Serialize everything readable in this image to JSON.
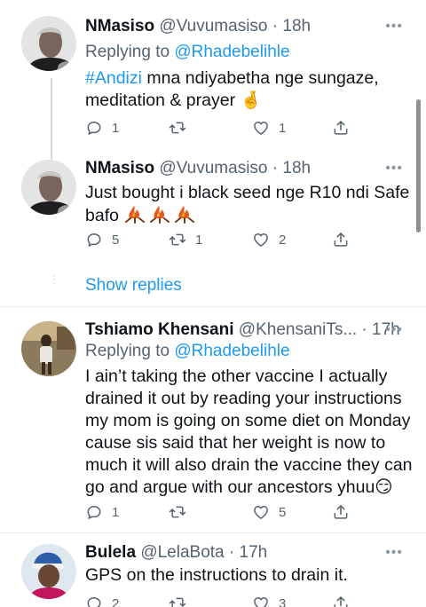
{
  "tweets": [
    {
      "name": "NMasiso",
      "handle": "@Vuvumasiso",
      "time": "18h",
      "replying_label": "Replying to",
      "replying_handle": "@Rhadebelihle",
      "hashtag": "#Andizi",
      "text_line1": " mna ndiyabetha nge sungaze,",
      "text_line2": "meditation & prayer",
      "emoji": "🤞",
      "replies": "1",
      "retweets": "",
      "likes": "1"
    },
    {
      "name": "NMasiso",
      "handle": "@Vuvumasiso",
      "time": "18h",
      "text_line1": "Just bought i black seed nge R10 ndi Safe",
      "text_line2": "bafo",
      "replies": "5",
      "retweets": "1",
      "likes": "2"
    },
    {
      "show_replies": "Show replies"
    },
    {
      "name": "Tshiamo Khensani",
      "handle": "@KhensaniTs...",
      "time": "17h",
      "replying_label": "Replying to",
      "replying_handle": "@Rhadebelihle",
      "lines": [
        "I ain’t taking the other vaccine I actually",
        "drained it out by reading your instructions",
        "my mom is going on some diet on Monday",
        "cause sis said that her weight is now to",
        "much it will also drain the vaccine they can",
        "go and argue with our ancestors yhuu"
      ],
      "emoji": "😏",
      "replies": "1",
      "retweets": "",
      "likes": "5"
    },
    {
      "name": "Bulela",
      "handle": "@LelaBota",
      "time": "17h",
      "text_line1": "GPS on the instructions to drain it.",
      "replies": "2",
      "retweets": "",
      "likes": "3"
    }
  ],
  "icons": [
    "reply-icon",
    "retweet-icon",
    "like-icon",
    "share-icon",
    "more-icon"
  ],
  "colors": {
    "link": "#1d9bf0",
    "secondary": "#536471",
    "text": "#0f1419",
    "thread_line": "#cfd9de"
  }
}
